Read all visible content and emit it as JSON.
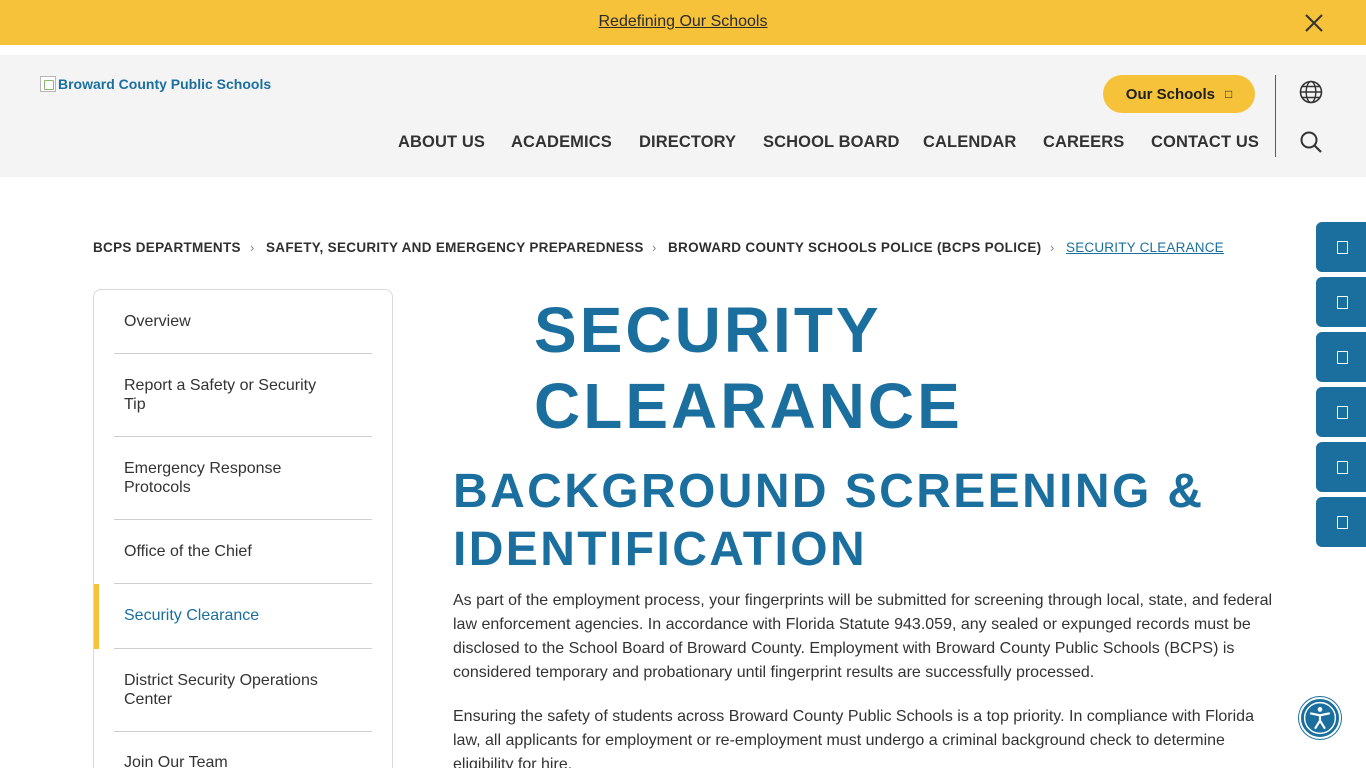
{
  "announcement": {
    "text": "Redefining Our Schools"
  },
  "header": {
    "logo_alt": "Broward County Public Schools",
    "our_schools_label": "Our Schools",
    "nav": [
      "ABOUT US",
      "ACADEMICS",
      "DIRECTORY",
      "SCHOOL BOARD",
      "CALENDAR",
      "CAREERS",
      "CONTACT US"
    ]
  },
  "breadcrumb": [
    "BCPS DEPARTMENTS",
    "SAFETY, SECURITY AND EMERGENCY PREPAREDNESS",
    "BROWARD COUNTY SCHOOLS POLICE (BCPS POLICE)",
    "SECURITY CLEARANCE"
  ],
  "sidebar": {
    "items": [
      "Overview",
      "Report a Safety or Security Tip",
      "Emergency Response Protocols",
      "Office of the Chief",
      "Security Clearance",
      "District Security Operations Center",
      "Join Our Team"
    ],
    "active": "Security Clearance"
  },
  "main": {
    "title": "SECURITY CLEARANCE",
    "section_title": "BACKGROUND SCREENING & IDENTIFICATION",
    "paragraphs": [
      "As part of the employment process, your fingerprints will be submitted for screening through local, state, and federal law enforcement agencies. In accordance with Florida Statute 943.059, any sealed or expunged records must be disclosed to the School Board of Broward County. Employment with Broward County Public Schools (BCPS) is considered temporary and probationary until fingerprint results are successfully processed.",
      "Ensuring the safety of students across Broward County Public Schools is a top priority. In compliance with Florida law, all applicants for employment or re-employment must undergo a criminal background check to determine eligibility for hire."
    ]
  },
  "icons": {
    "close": "close-icon",
    "globe": "globe-icon",
    "search": "search-icon",
    "accessibility": "accessibility-icon",
    "external": "external-link-icon",
    "chevron": "chevron-right-icon"
  },
  "colors": {
    "accent_blue": "#1b6f9e",
    "accent_yellow": "#f5c23a",
    "header_bg": "#f4f4f4"
  }
}
